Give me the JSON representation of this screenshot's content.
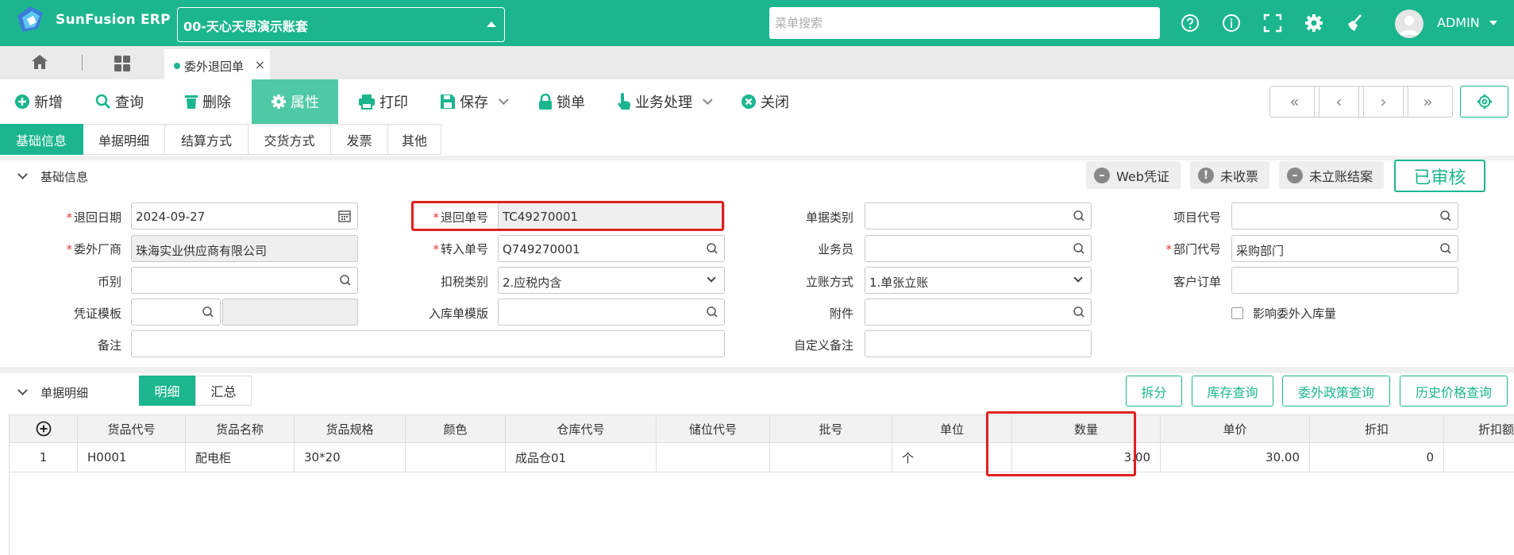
{
  "app": {
    "brand": "SunFusion ERP",
    "account": "00-天心天思演示账套",
    "search_placeholder": "菜单搜索",
    "user": "ADMIN",
    "accent": "#1bb68e"
  },
  "tabs": {
    "doc_tab": "委外退回单"
  },
  "toolbar": {
    "new": "新增",
    "query": "查询",
    "delete": "删除",
    "properties": "属性",
    "print": "打印",
    "save": "保存",
    "lock": "锁单",
    "business": "业务处理",
    "close": "关闭"
  },
  "section_tabs": [
    "基础信息",
    "单据明细",
    "结算方式",
    "交货方式",
    "发票",
    "其他"
  ],
  "basic": {
    "title": "基础信息",
    "chips": [
      "Web凭证",
      "未收票",
      "未立账结案"
    ],
    "status": "已审核",
    "labels": {
      "return_date": "退回日期",
      "return_no": "退回单号",
      "doc_type": "单据类别",
      "project_code": "项目代号",
      "vendor": "委外厂商",
      "transfer_no": "转入单号",
      "salesman": "业务员",
      "dept_code": "部门代号",
      "currency": "币别",
      "tax_type": "扣税类别",
      "account_method": "立账方式",
      "customer_order": "客户订单",
      "voucher_tpl": "凭证模板",
      "inbound_tpl": "入库单模版",
      "attachment": "附件",
      "affect_qty": "影响委外入库量",
      "remark": "备注",
      "custom_remark": "自定义备注"
    },
    "values": {
      "return_date": "2024-09-27",
      "return_no": "TC49270001",
      "vendor": "珠海实业供应商有限公司",
      "transfer_no": "Q749270001",
      "dept_code": "采购部门",
      "tax_type": "2.应税内含",
      "account_method": "1.单张立账"
    }
  },
  "detail": {
    "title": "单据明细",
    "segments": [
      "明细",
      "汇总"
    ],
    "buttons": [
      "拆分",
      "库存查询",
      "委外政策查询",
      "历史价格查询"
    ],
    "columns": [
      "货品代号",
      "货品名称",
      "货品规格",
      "颜色",
      "仓库代号",
      "储位代号",
      "批号",
      "单位",
      "数量",
      "单价",
      "折扣",
      "折扣额"
    ],
    "rows": [
      {
        "idx": "1",
        "code": "H0001",
        "name": "配电柜",
        "spec": "30*20",
        "color": "",
        "warehouse": "成品仓01",
        "location": "",
        "batch": "",
        "unit": "个",
        "qty": "3.00",
        "price": "30.00",
        "discount": "0",
        "discount_amt": ""
      }
    ]
  }
}
